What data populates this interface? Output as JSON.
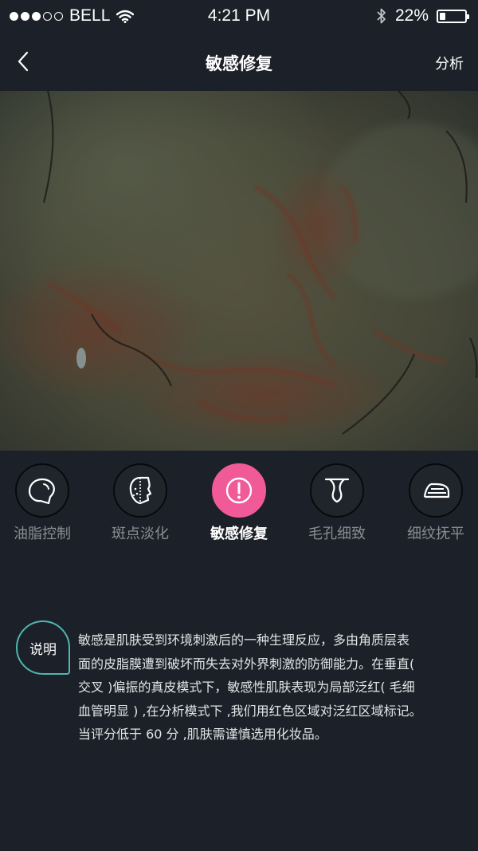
{
  "status_bar": {
    "carrier": "BELL",
    "time": "4:21 PM",
    "battery": "22%",
    "battery_level": 0.22,
    "signal_dots_filled": 3,
    "signal_dots_total": 5
  },
  "nav": {
    "title": "敏感修复",
    "right_action": "分析"
  },
  "modes": [
    {
      "label": "油脂控制",
      "icon": "oil-drop-icon",
      "active": false
    },
    {
      "label": "斑点淡化",
      "icon": "face-spot-icon",
      "active": false
    },
    {
      "label": "敏感修复",
      "icon": "alert-icon",
      "active": true
    },
    {
      "label": "毛孔细致",
      "icon": "pore-icon",
      "active": false
    },
    {
      "label": "细纹抚平",
      "icon": "iron-icon",
      "active": false
    }
  ],
  "description": {
    "badge": "说明",
    "lines": [
      "敏感是肌肤受到环境刺激后的一种生理反应，多由角质层表",
      "面的皮脂膜遭到破坏而失去对外界刺激的防御能力。在垂直(",
      "交叉 )偏振的真皮模式下，敏感性肌肤表现为局部泛红( 毛细",
      "血管明显 ) ,在分析模式下 ,我们用红色区域对泛红区域标记。",
      "当评分低于 60 分 ,肌肤需谨慎选用化妆品。"
    ]
  },
  "colors": {
    "background": "#1c2129",
    "accent_pink": "#f05a98",
    "badge_border": "#4fb6b2"
  }
}
